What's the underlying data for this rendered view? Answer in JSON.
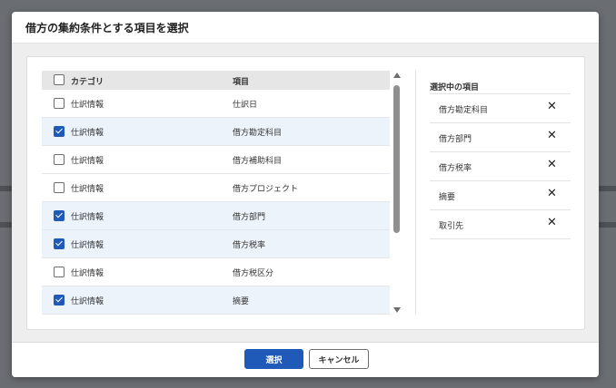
{
  "dialog": {
    "title": "借方の集約条件とする項目を選択"
  },
  "table": {
    "headers": {
      "category": "カテゴリ",
      "item": "項目"
    },
    "rows": [
      {
        "category": "仕訳情報",
        "item": "仕訳日",
        "checked": false
      },
      {
        "category": "仕訳情報",
        "item": "借方勘定科目",
        "checked": true
      },
      {
        "category": "仕訳情報",
        "item": "借方補助科目",
        "checked": false
      },
      {
        "category": "仕訳情報",
        "item": "借方プロジェクト",
        "checked": false
      },
      {
        "category": "仕訳情報",
        "item": "借方部門",
        "checked": true
      },
      {
        "category": "仕訳情報",
        "item": "借方税率",
        "checked": true
      },
      {
        "category": "仕訳情報",
        "item": "借方税区分",
        "checked": false
      },
      {
        "category": "仕訳情報",
        "item": "摘要",
        "checked": true
      }
    ]
  },
  "selected": {
    "title": "選択中の項目",
    "items": [
      {
        "label": "借方勘定科目",
        "remove_icon": "close-icon"
      },
      {
        "label": "借方部門",
        "remove_icon": "close-icon"
      },
      {
        "label": "借方税率",
        "remove_icon": "close-icon"
      },
      {
        "label": "摘要",
        "remove_icon": "close-icon"
      },
      {
        "label": "取引先",
        "remove_icon": "close-icon"
      }
    ],
    "remove_glyph": "✕"
  },
  "footer": {
    "select_label": "選択",
    "cancel_label": "キャンセル"
  },
  "colors": {
    "primary": "#1f5ab8",
    "row_selected": "#edf3fb"
  }
}
